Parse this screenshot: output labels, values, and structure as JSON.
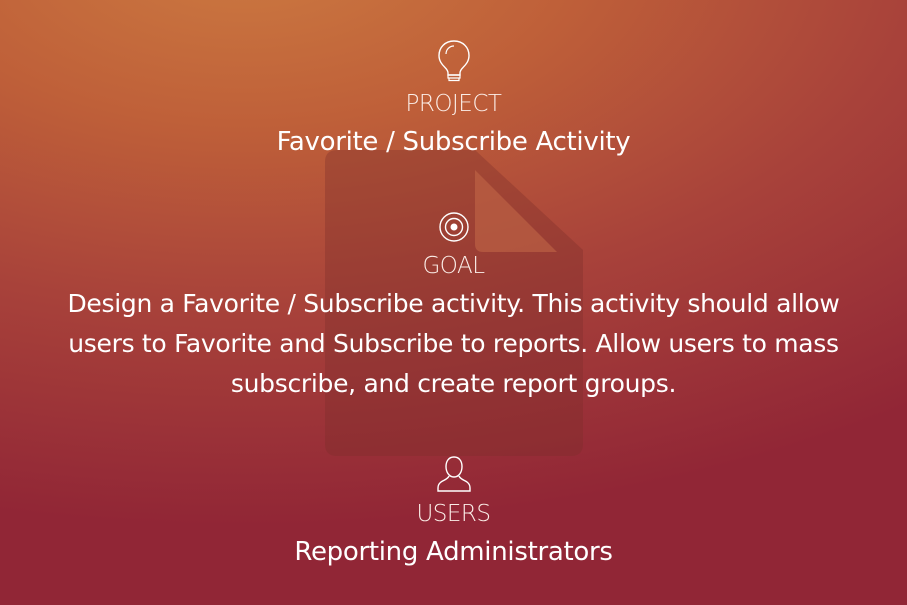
{
  "background": {
    "colors": [
      "#cc7a41",
      "#bf6039",
      "#a8423a",
      "#912636"
    ],
    "watermark_icon": "document-icon"
  },
  "project": {
    "icon": "lightbulb-icon",
    "label": "PROJECT",
    "value": "Favorite / Subscribe Activity"
  },
  "goal": {
    "icon": "target-icon",
    "label": "GOAL",
    "value": "Design a Favorite / Subscribe activity. This activity should allow users to Favorite and Subscribe to reports. Allow users to mass subscribe, and create report groups."
  },
  "users": {
    "icon": "user-icon",
    "label": "USERS",
    "value": "Reporting Administrators"
  }
}
